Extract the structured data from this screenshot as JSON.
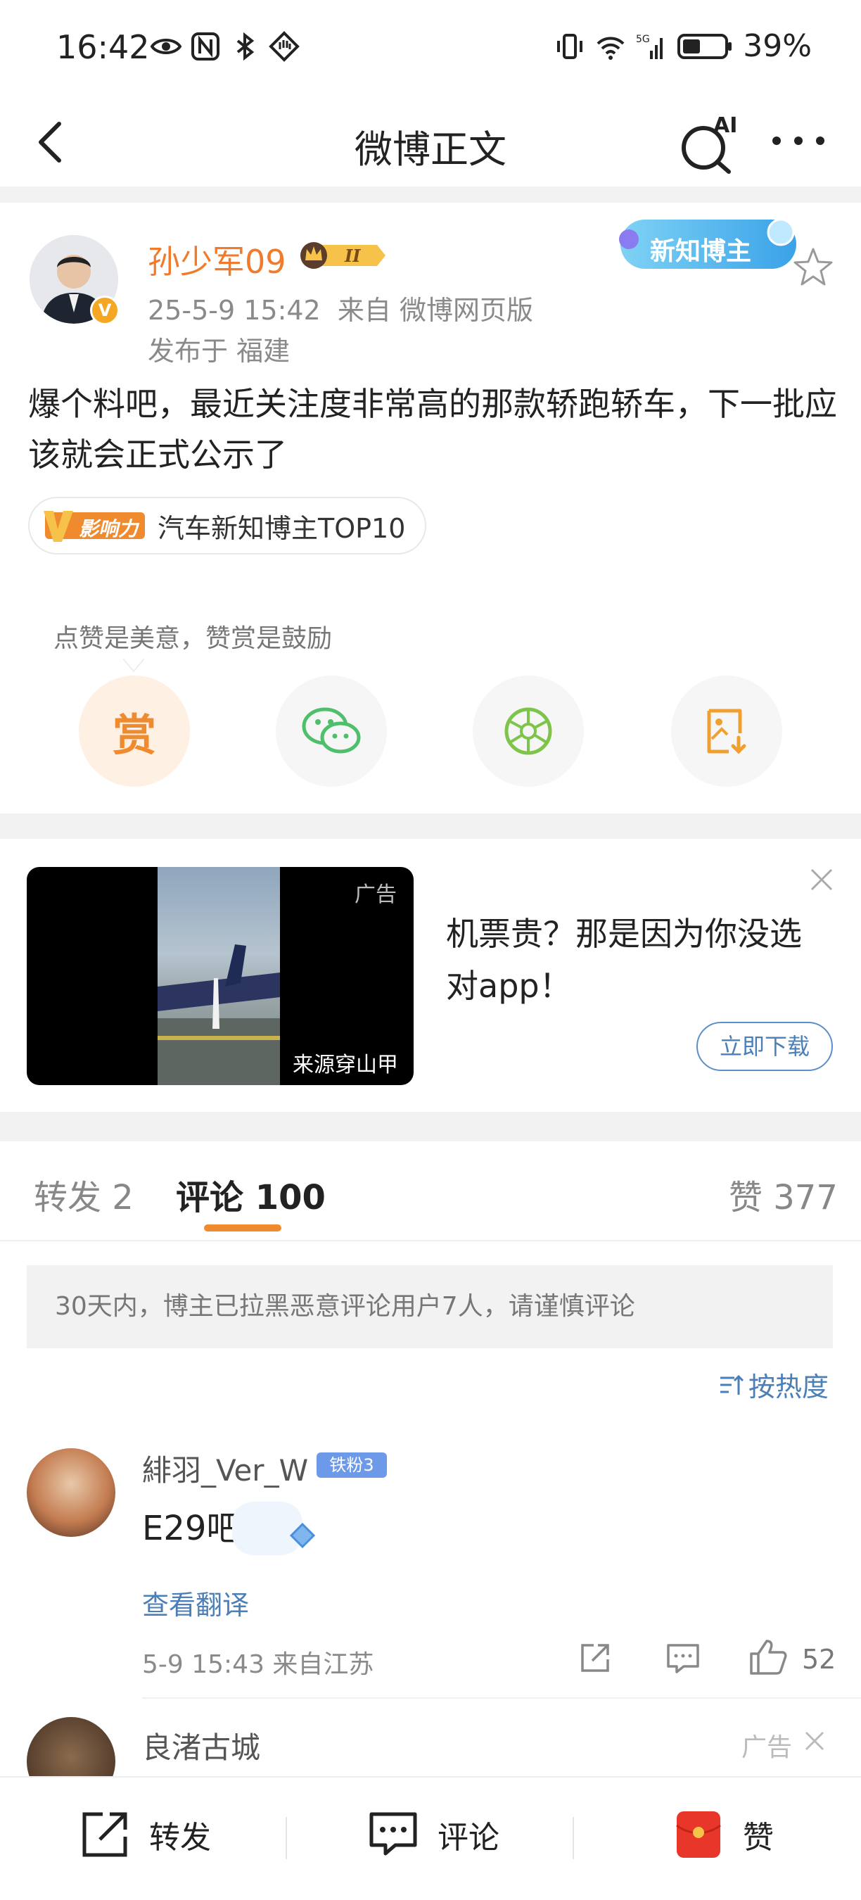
{
  "status_bar": {
    "time": "16:42",
    "battery": "39%"
  },
  "nav": {
    "title": "微博正文",
    "ai_label": "AI"
  },
  "post": {
    "author": "孙少军09",
    "level_badge": "II",
    "new_blogger_badge": "新知博主",
    "meta": "25-5-9 15:42  来自 微博网页版",
    "location": "发布于 福建",
    "text": "爆个料吧，最近关注度非常高的那款轿跑轿车，下一批应该就会正式公示了",
    "influence_logo_text": "影响力",
    "influence_tag": "汽车新知博主TOP10",
    "reward_tip": "点赞是美意，赞赏是鼓励",
    "reward_label": "赏"
  },
  "ad": {
    "video_label": "广告",
    "source": "来源穿山甲",
    "headline": "机票贵？那是因为你没选对app！",
    "cta": "立即下载"
  },
  "tabs": {
    "repost": "转发 2",
    "comments": "评论 100",
    "likes": "赞 377"
  },
  "notice": "30天内，博主已拉黑恶意评论用户7人，请谨慎评论",
  "sort": "按热度",
  "comments": [
    {
      "user": "緋羽_Ver_W",
      "fan_badge": "铁粉3",
      "text": "E29吧",
      "translate": "查看翻译",
      "meta": "5-9 15:43 来自江苏",
      "likes": "52"
    },
    {
      "user": "良渚古城",
      "ad_label": "广告"
    }
  ],
  "bottom_bar": {
    "repost": "转发",
    "comment": "评论",
    "like": "赞"
  },
  "colors": {
    "accent_orange": "#f08a2e",
    "link_blue": "#4a7fb8",
    "name_orange": "#f07b2d"
  }
}
